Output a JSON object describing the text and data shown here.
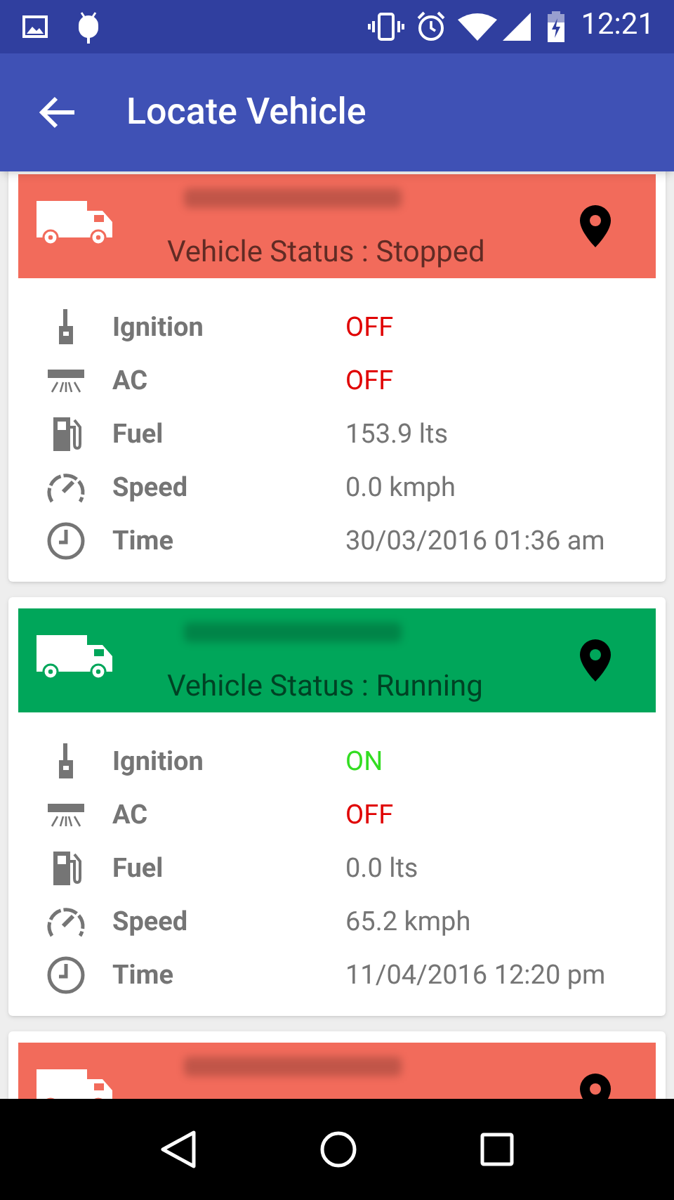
{
  "status_bar": {
    "time": "12:21"
  },
  "app_bar": {
    "title": "Locate Vehicle"
  },
  "vehicles": [
    {
      "color": "#f26b5b",
      "status": "Vehicle Status : Stopped",
      "rows": [
        {
          "kind": "ignition",
          "label": "Ignition",
          "value": "OFF",
          "on": false
        },
        {
          "kind": "ac",
          "label": "AC",
          "value": "OFF",
          "on": false
        },
        {
          "kind": "fuel",
          "label": "Fuel",
          "value": "153.9 lts"
        },
        {
          "kind": "speed",
          "label": "Speed",
          "value": "0.0 kmph"
        },
        {
          "kind": "time",
          "label": "Time",
          "value": "30/03/2016 01:36 am"
        }
      ]
    },
    {
      "color": "#00a65a",
      "status": "Vehicle Status : Running",
      "rows": [
        {
          "kind": "ignition",
          "label": "Ignition",
          "value": "ON",
          "on": true
        },
        {
          "kind": "ac",
          "label": "AC",
          "value": "OFF",
          "on": false
        },
        {
          "kind": "fuel",
          "label": "Fuel",
          "value": "0.0 lts"
        },
        {
          "kind": "speed",
          "label": "Speed",
          "value": "65.2 kmph"
        },
        {
          "kind": "time",
          "label": "Time",
          "value": "11/04/2016 12:20 pm"
        }
      ]
    },
    {
      "color": "#f26b5b"
    }
  ]
}
